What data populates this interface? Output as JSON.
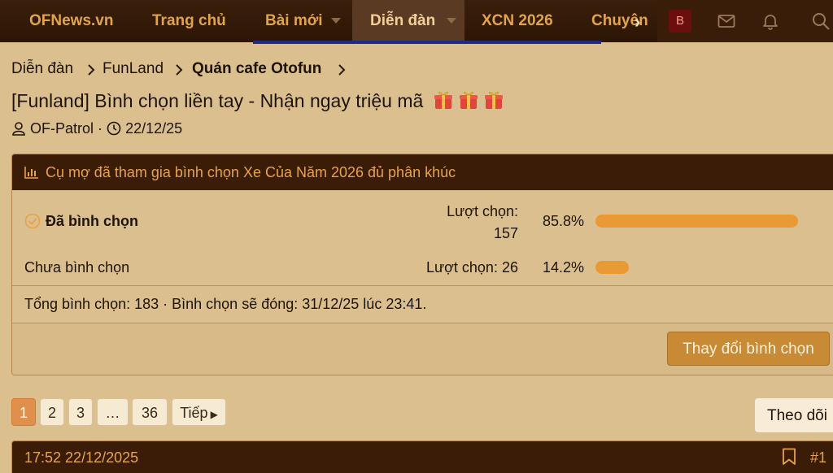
{
  "nav": {
    "site_name": "OFNews.vn",
    "items": [
      "Trang chủ",
      "Bài mới",
      "Diễn đàn",
      "XCN 2026",
      "Chuyên"
    ],
    "avatar_letter": "B",
    "icons": [
      "envelope-icon",
      "bell-icon",
      "search-icon"
    ],
    "colors": {
      "bar": "#2d1606",
      "link": "#e0a44a",
      "active": "#5a3a22"
    }
  },
  "breadcrumb": [
    "Diễn đàn",
    "FunLand",
    "Quán cafe Otofun"
  ],
  "thread": {
    "title": "[Funland] Bình chọn liền tay - Nhận ngay triệu mã",
    "author": "OF-Patrol",
    "separator": "·",
    "date": "22/12/25"
  },
  "poll": {
    "header": "Cụ mợ đã tham gia bình chọn Xe Của Năm 2026 đủ phân khúc",
    "votes_prefix": "Lượt chọn:",
    "options": [
      {
        "label": "Đã bình chọn",
        "votes": "157",
        "percent_text": "85.8%",
        "fraction": 0.858,
        "selected": true
      },
      {
        "label": "Chưa bình chọn",
        "votes": "26",
        "percent_text": "14.2%",
        "fraction": 0.142,
        "selected": false
      }
    ],
    "total_text": "Tổng bình chọn: 183 · Bình chọn sẽ đóng: 31/12/25 lúc 23:41.",
    "change_button": "Thay đổi bình chọn",
    "bar_color": "#e99a35"
  },
  "pagination": {
    "pages": [
      "1",
      "2",
      "3",
      "…",
      "36"
    ],
    "current": "1",
    "next": "Tiếp"
  },
  "follow_button": "Theo dõi",
  "post": {
    "timestamp": "17:52 22/12/2025",
    "number": "#1"
  }
}
